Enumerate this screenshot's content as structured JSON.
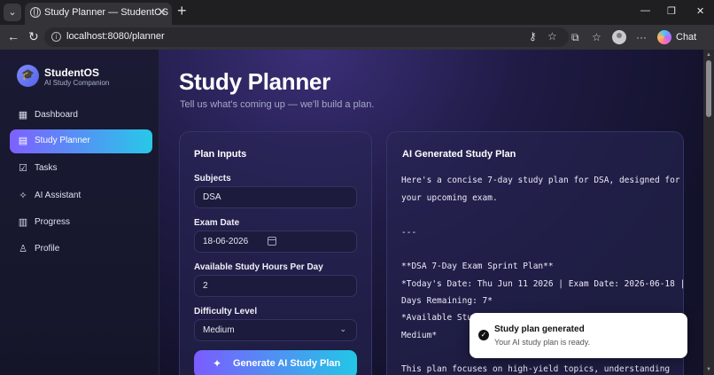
{
  "browser": {
    "tab_title": "Study Planner — StudentOS",
    "url": "localhost:8080/planner",
    "chat_label": "Chat"
  },
  "sidebar": {
    "brand": "StudentOS",
    "tagline": "AI Study Companion",
    "active": "Study Planner",
    "items": [
      {
        "label": "Dashboard",
        "icon": "grid-icon"
      },
      {
        "label": "Study Planner",
        "icon": "calendar-icon"
      },
      {
        "label": "Tasks",
        "icon": "checkbox-icon"
      },
      {
        "label": "AI Assistant",
        "icon": "sparkles-icon"
      },
      {
        "label": "Progress",
        "icon": "bar-chart-icon"
      },
      {
        "label": "Profile",
        "icon": "user-icon"
      }
    ]
  },
  "page": {
    "title": "Study Planner",
    "subtitle": "Tell us what's coming up — we'll build a plan."
  },
  "inputs": {
    "title": "Plan Inputs",
    "subjects_label": "Subjects",
    "subjects_value": "DSA",
    "exam_date_label": "Exam Date",
    "exam_date_value": "18-06-2026",
    "hours_label": "Available Study Hours Per Day",
    "hours_value": "2",
    "difficulty_label": "Difficulty Level",
    "difficulty_value": "Medium",
    "generate_label": "Generate AI Study Plan"
  },
  "plan": {
    "title": "AI Generated Study Plan",
    "lines": [
      "Here's a concise 7-day study plan for DSA, designed for",
      "your upcoming exam.",
      "",
      "---",
      "",
      "**DSA 7-Day Exam Sprint Plan**",
      "*Today's Date: Thu Jun 11 2026 | Exam Date: 2026-06-18 |",
      "Days Remaining: 7*",
      "*Available Stud",
      "Medium*",
      "",
      "This plan focuses on high-yield topics, understanding"
    ]
  },
  "toast": {
    "title": "Study plan generated",
    "message": "Your AI study plan is ready."
  },
  "colors": {
    "accent_start": "#7e60ff",
    "accent_end": "#28c8e8",
    "background": "#131229"
  }
}
